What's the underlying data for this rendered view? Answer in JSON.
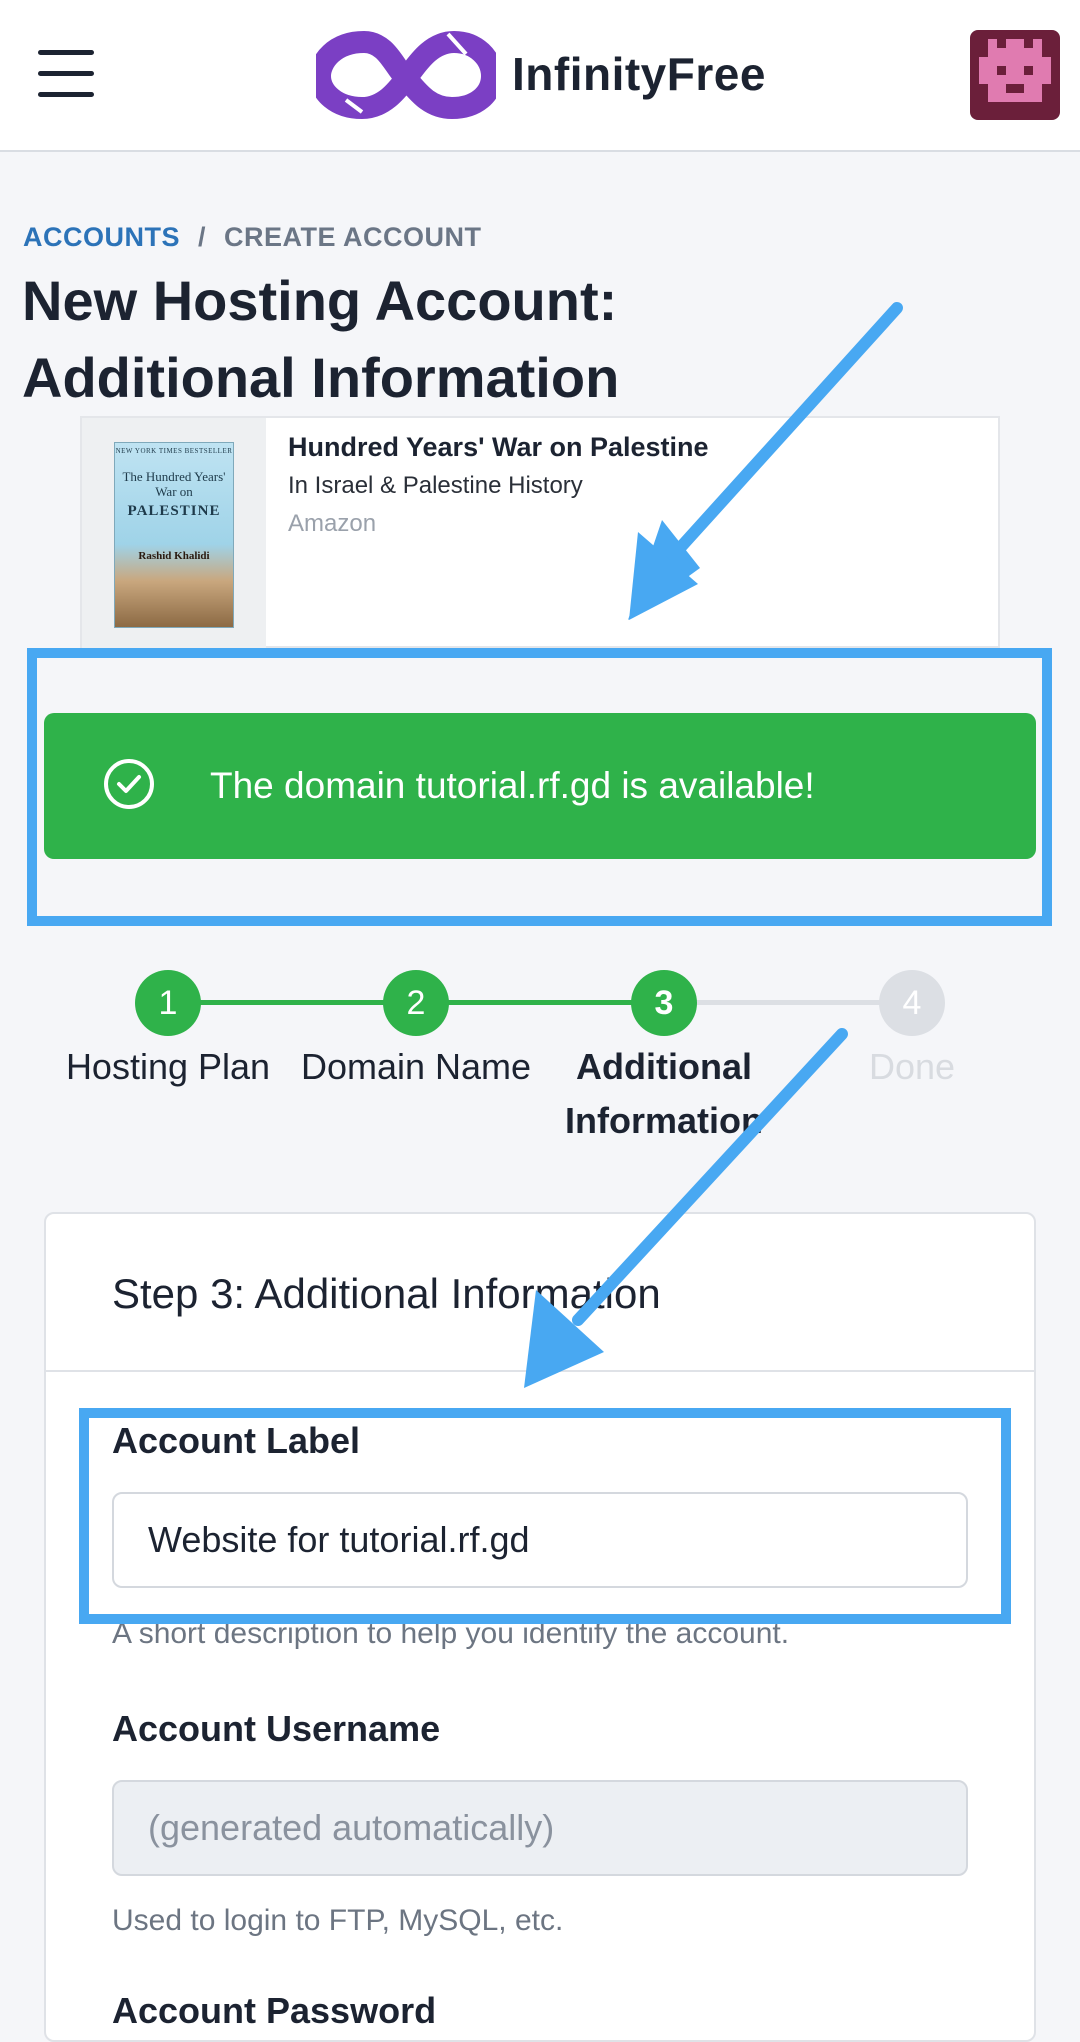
{
  "header": {
    "brand": "InfinityFree"
  },
  "breadcrumb": {
    "link": "ACCOUNTS",
    "separator": "/",
    "current": "CREATE ACCOUNT"
  },
  "page_title": "New Hosting Account: Additional Information",
  "ad": {
    "title": "Hundred Years' War on Palestine",
    "subtitle": "In Israel & Palestine History",
    "source": "Amazon",
    "book_cover": {
      "banner": "NEW YORK TIMES BESTSELLER",
      "title_line": "The Hundred Years' War on",
      "title_main": "PALESTINE",
      "author": "Rashid Khalidi"
    }
  },
  "alert": {
    "icon": "check-circle-icon",
    "message": "The domain tutorial.rf.gd is available!",
    "color": "#2fb24a"
  },
  "stepper": {
    "steps": [
      {
        "number": "1",
        "label": "Hosting Plan",
        "status": "complete"
      },
      {
        "number": "2",
        "label": "Domain Name",
        "status": "complete"
      },
      {
        "number": "3",
        "label": "Additional Information",
        "status": "current"
      },
      {
        "number": "4",
        "label": "Done",
        "status": "upcoming"
      }
    ]
  },
  "form": {
    "title": "Step 3: Additional Information",
    "account_label": {
      "label": "Account Label",
      "value": "Website for tutorial.rf.gd",
      "help": "A short description to help you identify the account."
    },
    "account_username": {
      "label": "Account Username",
      "placeholder": "(generated automatically)",
      "help": "Used to login to FTP, MySQL, etc."
    },
    "account_password": {
      "label": "Account Password"
    }
  },
  "colors": {
    "accent_link": "#2c73b8",
    "success": "#2fb24a",
    "annotation": "#48a8f2"
  }
}
